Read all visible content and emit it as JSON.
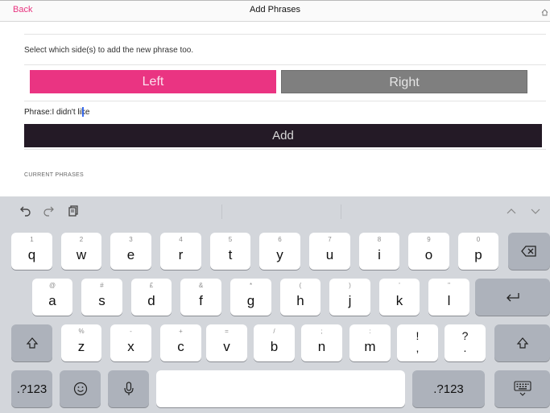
{
  "nav": {
    "back_label": "Back",
    "title": "Add Phrases",
    "right_icon": "home-icon"
  },
  "form": {
    "select_label": "Select which side(s) to add the new phrase too.",
    "left_label": "Left",
    "right_label": "Right",
    "phrase_prefix": "Phrase:",
    "phrase_value": "I didn't like",
    "add_label": "Add",
    "current_phrases_label": "CURRENT PHRASES"
  },
  "colors": {
    "accent": "#ea3482",
    "unselected": "#7f7f7f",
    "add_bg": "#241a26"
  },
  "keyboard": {
    "toolbar_icons": [
      "undo-icon",
      "redo-icon",
      "paste-icon",
      "chevron-up-icon",
      "chevron-down-icon"
    ],
    "row1": [
      {
        "hint": "1",
        "label": "q"
      },
      {
        "hint": "2",
        "label": "w"
      },
      {
        "hint": "3",
        "label": "e"
      },
      {
        "hint": "4",
        "label": "r"
      },
      {
        "hint": "5",
        "label": "t"
      },
      {
        "hint": "6",
        "label": "y"
      },
      {
        "hint": "7",
        "label": "u"
      },
      {
        "hint": "8",
        "label": "i"
      },
      {
        "hint": "9",
        "label": "o"
      },
      {
        "hint": "0",
        "label": "p"
      }
    ],
    "row2": [
      {
        "hint": "@",
        "label": "a"
      },
      {
        "hint": "#",
        "label": "s"
      },
      {
        "hint": "£",
        "label": "d"
      },
      {
        "hint": "&",
        "label": "f"
      },
      {
        "hint": "*",
        "label": "g"
      },
      {
        "hint": "(",
        "label": "h"
      },
      {
        "hint": ")",
        "label": "j"
      },
      {
        "hint": "'",
        "label": "k"
      },
      {
        "hint": "\"",
        "label": "l"
      }
    ],
    "row3": [
      {
        "hint": "%",
        "label": "z"
      },
      {
        "hint": "-",
        "label": "x"
      },
      {
        "hint": "+",
        "label": "c"
      },
      {
        "hint": "=",
        "label": "v"
      },
      {
        "hint": "/",
        "label": "b"
      },
      {
        "hint": ";",
        "label": "n"
      },
      {
        "hint": ":",
        "label": "m"
      }
    ],
    "row3_punct": [
      {
        "top": "!",
        "bottom": ","
      },
      {
        "top": "?",
        "bottom": "."
      }
    ],
    "numbers_label": ".?123",
    "emoji_icon": "emoji-icon",
    "mic_icon": "microphone-icon",
    "delete_icon": "delete-icon",
    "return_icon": "return-icon",
    "shift_icon": "shift-icon",
    "hide_keyboard_icon": "keyboard-dismiss-icon"
  }
}
